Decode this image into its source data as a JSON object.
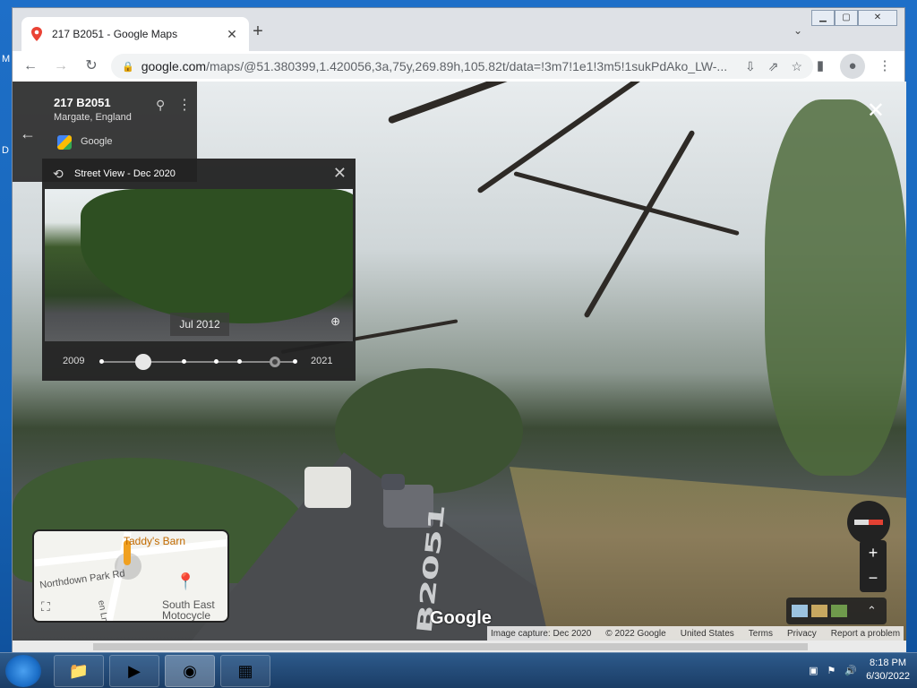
{
  "browser": {
    "tab_title": "217 B2051 - Google Maps",
    "url_host": "google.com",
    "url_rest": "/maps/@51.380399,1.420056,3a,75y,269.89h,105.82t/data=!3m7!1e1!3m5!1sukPdAko_LW-..."
  },
  "place_card": {
    "title": "217 B2051",
    "subtitle": "Margate, England",
    "provider": "Google"
  },
  "time_machine": {
    "header": "Street View - Dec 2020",
    "thumb_date": "Jul 2012",
    "year_start": "2009",
    "year_end": "2021",
    "selected_fraction": 0.22
  },
  "minimap": {
    "poi": "Taddy's Barn",
    "street1": "Northdown Park Rd",
    "street2": "en Ln",
    "place": "South East Motocycle"
  },
  "map": {
    "road_marking": "B2051",
    "logo": "Google"
  },
  "footer": {
    "capture": "Image capture: Dec 2020",
    "copyright": "© 2022 Google",
    "country": "United States",
    "terms": "Terms",
    "privacy": "Privacy",
    "report": "Report a problem"
  },
  "taskbar": {
    "time": "8:18 PM",
    "date": "6/30/2022"
  },
  "desktop": {
    "frag1": "M",
    "frag2": "D"
  }
}
